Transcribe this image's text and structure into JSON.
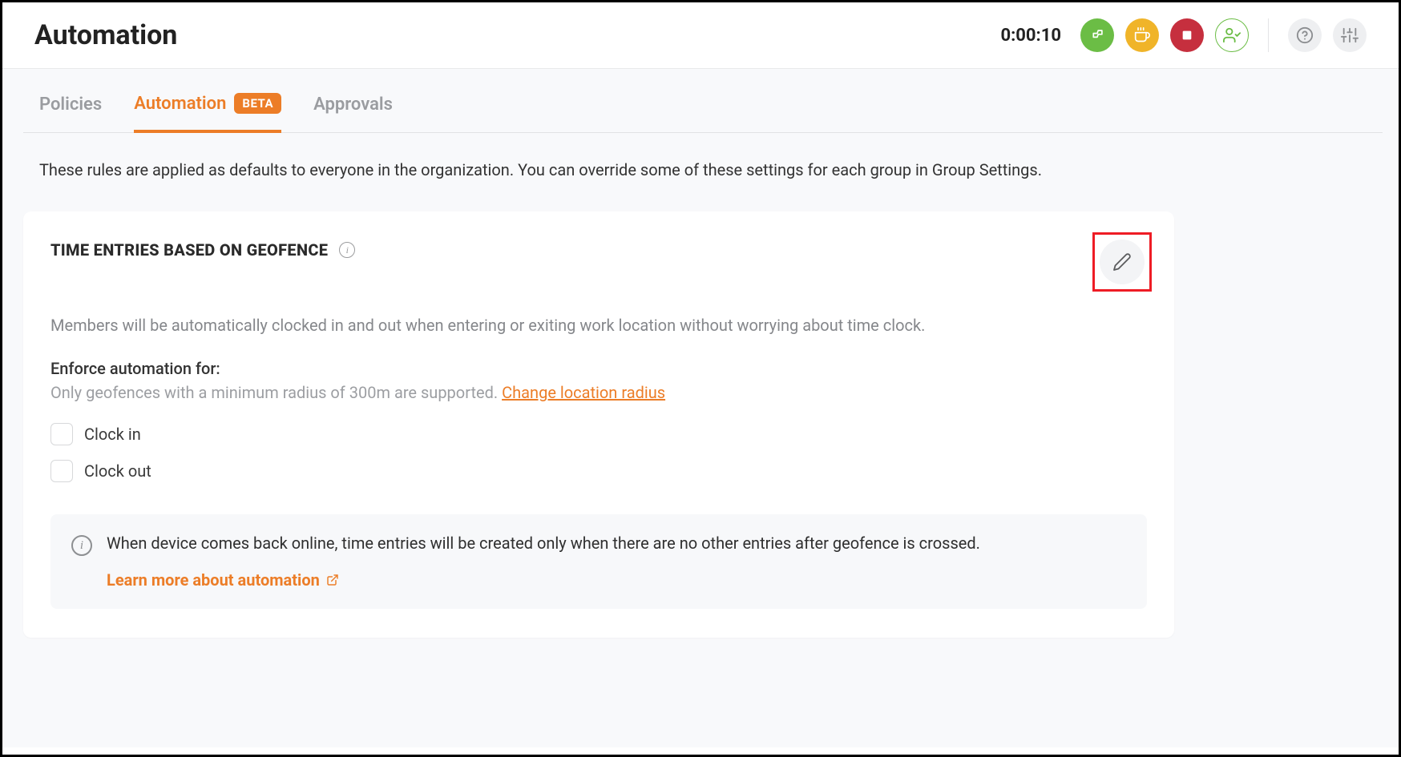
{
  "header": {
    "title": "Automation",
    "timer": "0:00:10"
  },
  "tabs": {
    "policies": "Policies",
    "automation": "Automation",
    "automation_badge": "BETA",
    "approvals": "Approvals"
  },
  "description": "These rules are applied as defaults to everyone in the organization. You can override some of these settings for each group in Group Settings.",
  "card": {
    "title": "TIME ENTRIES BASED ON GEOFENCE",
    "subtitle": "Members will be automatically clocked in and out when entering or exiting work location without worrying about time clock.",
    "enforce_label": "Enforce automation for:",
    "enforce_note": "Only geofences with a minimum radius of 300m are supported. ",
    "change_radius_link": "Change location radius",
    "checkbox_in": "Clock in",
    "checkbox_out": "Clock out",
    "info_text": "When device comes back online, time entries will be created only when there are no other entries after geofence is crossed.",
    "learn_more": "Learn more about automation"
  }
}
